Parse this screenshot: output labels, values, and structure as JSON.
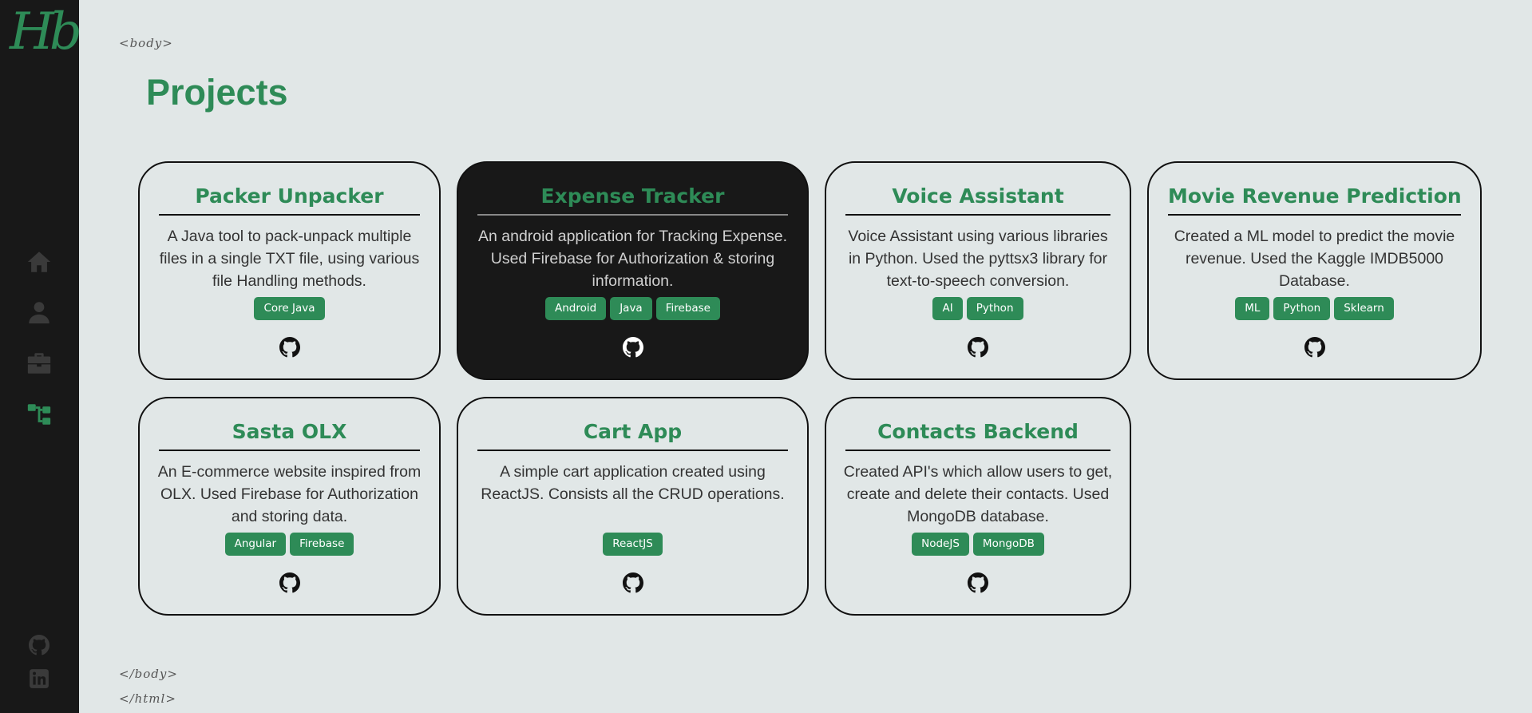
{
  "logo": "Hb",
  "sidebar": {
    "nav": [
      {
        "name": "home-icon",
        "active": false
      },
      {
        "name": "user-icon",
        "active": false
      },
      {
        "name": "briefcase-icon",
        "active": false
      },
      {
        "name": "projects-tree-icon",
        "active": true
      }
    ],
    "social": [
      {
        "name": "github-icon"
      },
      {
        "name": "linkedin-icon"
      }
    ]
  },
  "tags": {
    "body_open": "<body>",
    "body_close": "</body>",
    "html_close": "</html>"
  },
  "page": {
    "title": "Projects"
  },
  "colors": {
    "accent": "#2e8b57",
    "sidebar": "#181818",
    "background": "#e1e7e7"
  },
  "projects": [
    {
      "title": "Packer Unpacker",
      "description": "A Java tool to pack-unpack multiple files in a single TXT file, using various file Handling methods.",
      "tags": [
        "Core Java"
      ],
      "link_icon": "github-icon"
    },
    {
      "title": "Expense Tracker",
      "description": "An android application for Tracking Expense. Used Firebase for Authorization & storing information.",
      "tags": [
        "Android",
        "Java",
        "Firebase"
      ],
      "link_icon": "github-icon",
      "highlighted": true
    },
    {
      "title": "Voice Assistant",
      "description": "Voice Assistant using various libraries in Python. Used the pyttsx3 library for text-to-speech conversion.",
      "tags": [
        "AI",
        "Python"
      ],
      "link_icon": "github-icon"
    },
    {
      "title": "Movie Revenue Prediction",
      "description": "Created a ML model to predict the movie revenue. Used the Kaggle IMDB5000 Database.",
      "tags": [
        "ML",
        "Python",
        "Sklearn"
      ],
      "link_icon": "github-icon"
    },
    {
      "title": "Sasta OLX",
      "description": "An E-commerce website inspired from OLX. Used Firebase for Authorization and storing data.",
      "tags": [
        "Angular",
        "Firebase"
      ],
      "link_icon": "github-icon"
    },
    {
      "title": "Cart App",
      "description": "A simple cart application created using ReactJS. Consists all the CRUD operations.",
      "tags": [
        "ReactJS"
      ],
      "link_icon": "github-icon"
    },
    {
      "title": "Contacts Backend",
      "description": "Created API's which allow users to get, create and delete their contacts. Used MongoDB database.",
      "tags": [
        "NodeJS",
        "MongoDB"
      ],
      "link_icon": "github-icon"
    }
  ]
}
